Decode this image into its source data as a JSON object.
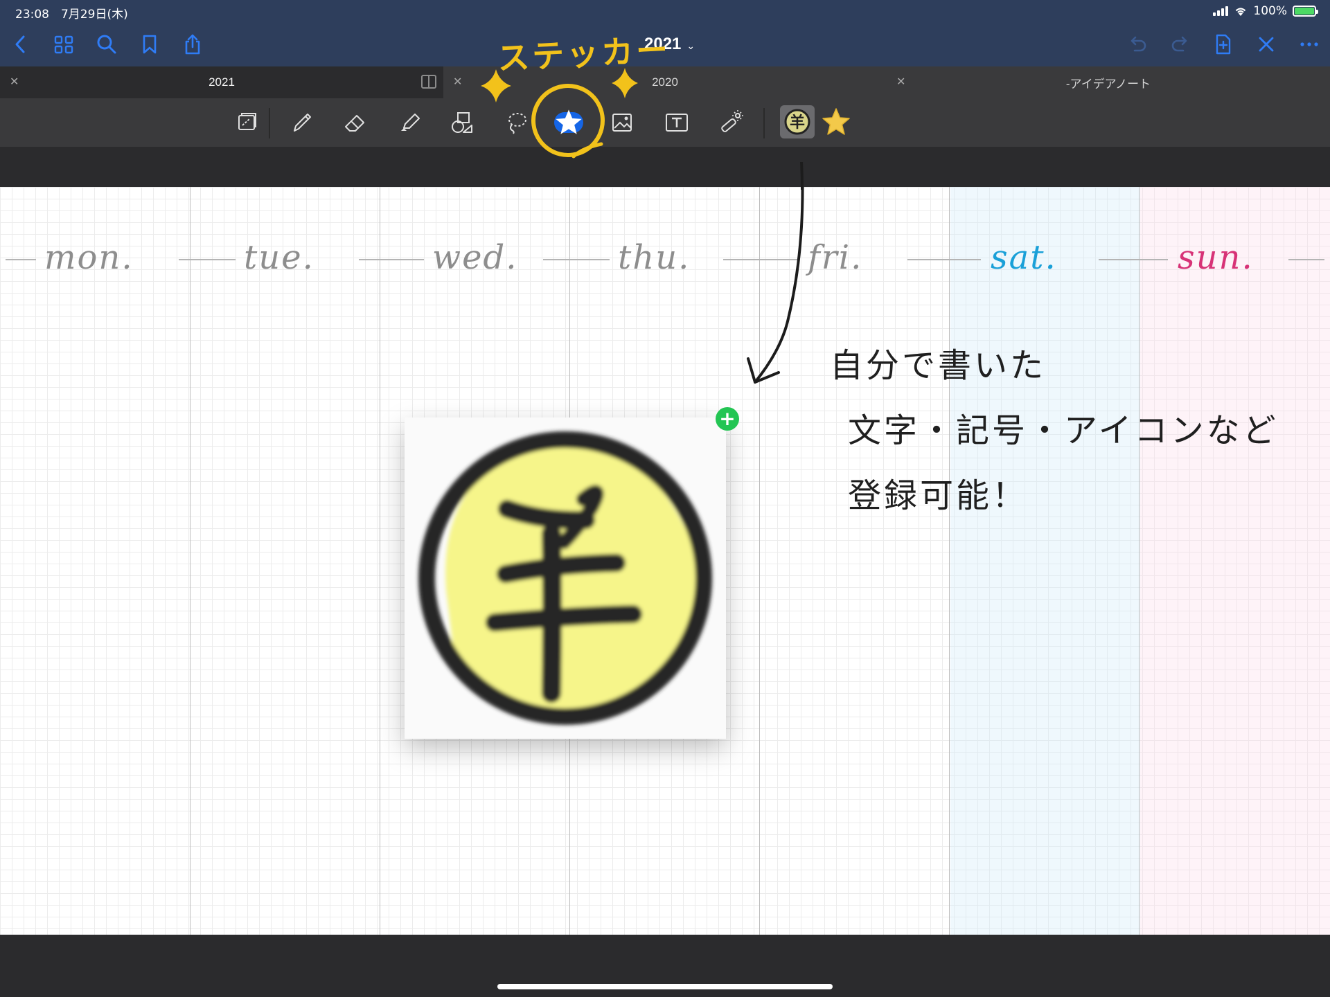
{
  "status": {
    "time": "23:08　7月29日(木)",
    "battery": "100%"
  },
  "nav": {
    "title": "2021",
    "left_icons": [
      "back-icon",
      "grid-icon",
      "search-icon",
      "bookmark-icon",
      "share-icon"
    ],
    "right_icons": [
      "undo-icon",
      "redo-icon",
      "add-page-icon",
      "close-icon",
      "more-icon"
    ],
    "accent": "#2f7cf6"
  },
  "tabs": [
    {
      "label": "2021",
      "active": true
    },
    {
      "label": "2020",
      "active": false
    },
    {
      "label": "-アイデアノート",
      "active": false
    }
  ],
  "toolbar": {
    "tools": [
      "read-only-icon",
      "pen-icon",
      "eraser-icon",
      "highlighter-icon",
      "shapes-icon",
      "lasso-icon",
      "sticker-icon",
      "image-icon",
      "text-icon",
      "laser-pointer-icon"
    ],
    "active_tool": "sticker-icon",
    "presets": [
      "hitsuji-sticker-icon",
      "star-sticker-icon"
    ]
  },
  "annotation": {
    "label": "ステッカー",
    "color": "#f2c21b"
  },
  "planner": {
    "days": [
      "mon.",
      "tue.",
      "wed.",
      "thu.",
      "fri.",
      "sat.",
      "sun."
    ],
    "note_lines": [
      "自分で書いた",
      "文字・記号・アイコンなど",
      "登録可能！"
    ],
    "sat_color": "#1aa0d8",
    "sun_color": "#d73377"
  },
  "sticker": {
    "glyph": "羊",
    "fill_color": "#f6f58a"
  },
  "add_badge": "+"
}
